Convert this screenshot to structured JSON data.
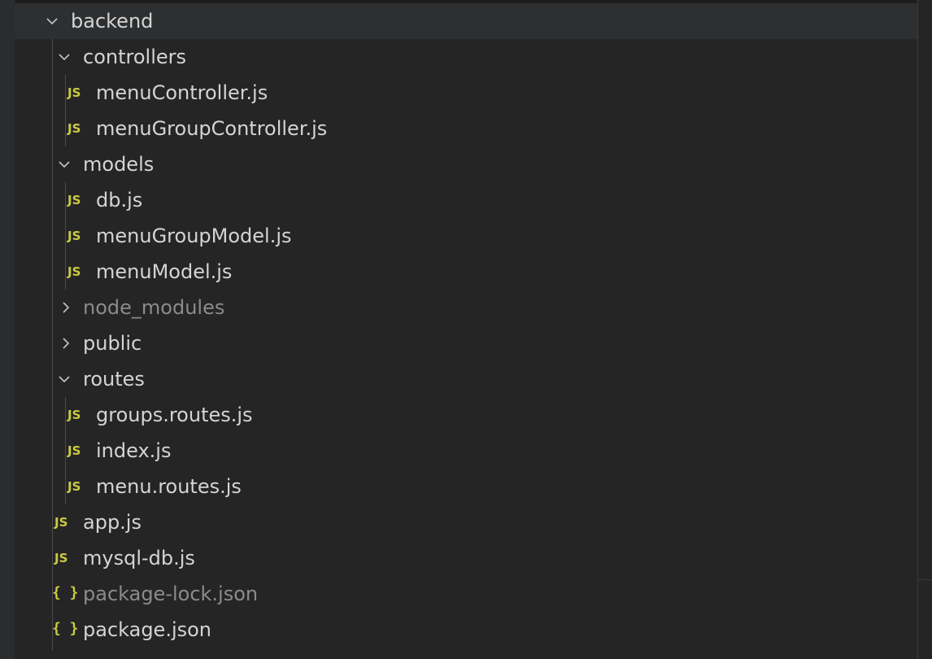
{
  "explorer": {
    "root": {
      "label": "backend",
      "expanded": true
    },
    "items": [
      {
        "label": "controllers",
        "type": "folder",
        "expanded": true,
        "depth": 1
      },
      {
        "label": "menuController.js",
        "type": "js",
        "badge": "JS",
        "depth": 2
      },
      {
        "label": "menuGroupController.js",
        "type": "js",
        "badge": "JS",
        "depth": 2
      },
      {
        "label": "models",
        "type": "folder",
        "expanded": true,
        "depth": 1
      },
      {
        "label": "db.js",
        "type": "js",
        "badge": "JS",
        "depth": 2
      },
      {
        "label": "menuGroupModel.js",
        "type": "js",
        "badge": "JS",
        "depth": 2
      },
      {
        "label": "menuModel.js",
        "type": "js",
        "badge": "JS",
        "depth": 2
      },
      {
        "label": "node_modules",
        "type": "folder",
        "expanded": false,
        "depth": 1,
        "dimmed": true
      },
      {
        "label": "public",
        "type": "folder",
        "expanded": false,
        "depth": 1
      },
      {
        "label": "routes",
        "type": "folder",
        "expanded": true,
        "depth": 1
      },
      {
        "label": "groups.routes.js",
        "type": "js",
        "badge": "JS",
        "depth": 2
      },
      {
        "label": "index.js",
        "type": "js",
        "badge": "JS",
        "depth": 2
      },
      {
        "label": "menu.routes.js",
        "type": "js",
        "badge": "JS",
        "depth": 2
      },
      {
        "label": "app.js",
        "type": "js",
        "badge": "JS",
        "depth": 1
      },
      {
        "label": "mysql-db.js",
        "type": "js",
        "badge": "JS",
        "depth": 1
      },
      {
        "label": "package-lock.json",
        "type": "json",
        "badge": "{ }",
        "depth": 1,
        "dimmed": true
      },
      {
        "label": "package.json",
        "type": "json",
        "badge": "{ }",
        "depth": 1
      }
    ]
  },
  "colors": {
    "background": "#252526",
    "text": "#d4d4d4",
    "dim_text": "#8b8b8b",
    "badge": "#cbcb41",
    "guide": "#4b4b4b"
  },
  "icons": {
    "expanded": "chevron-down-icon",
    "collapsed": "chevron-right-icon",
    "js_file": "js-file-icon",
    "json_file": "json-file-icon"
  }
}
